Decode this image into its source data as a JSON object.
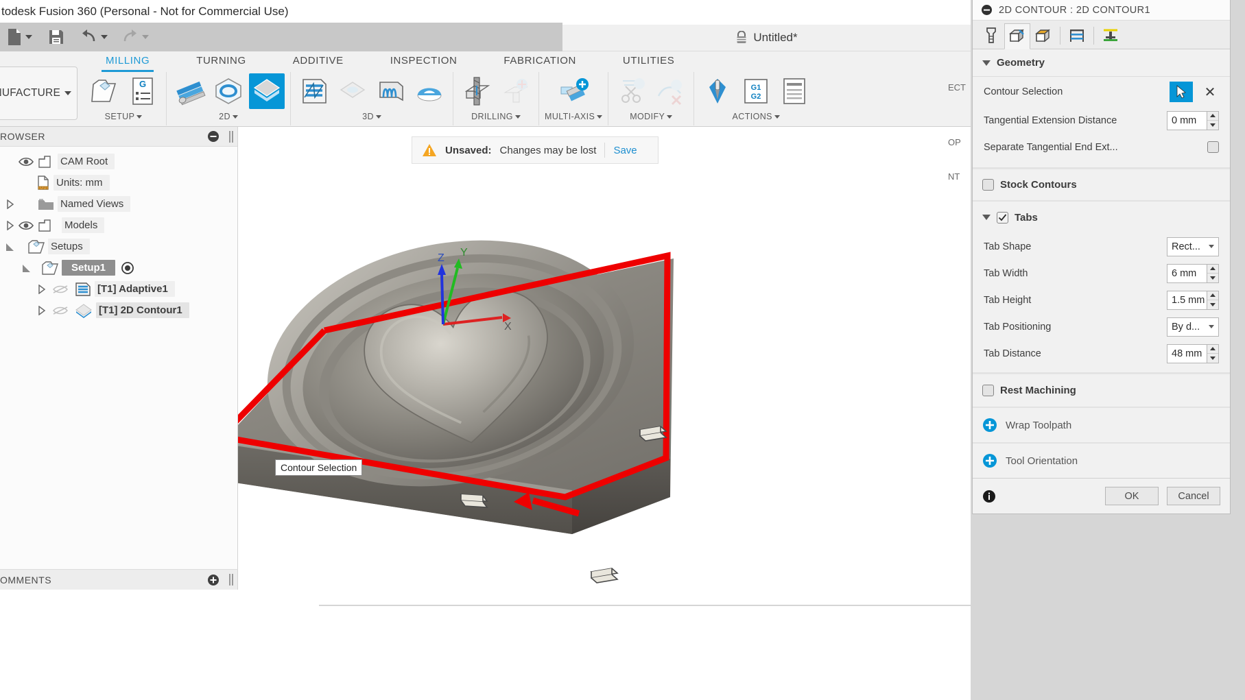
{
  "app": {
    "title": "todesk Fusion 360 (Personal - Not for Commercial Use)",
    "document_tab": "Untitled*"
  },
  "quick_access": {
    "new_label": "new-file",
    "save_label": "save",
    "undo_label": "undo",
    "redo_label": "redo"
  },
  "workspace": {
    "label": "ANUFACTURE"
  },
  "ribbon": {
    "tabs": [
      {
        "label": "MILLING",
        "active": true
      },
      {
        "label": "TURNING",
        "active": false
      },
      {
        "label": "ADDITIVE",
        "active": false
      },
      {
        "label": "INSPECTION",
        "active": false
      },
      {
        "label": "FABRICATION",
        "active": false
      },
      {
        "label": "UTILITIES",
        "active": false
      }
    ],
    "groups": [
      {
        "label": "SETUP",
        "has_caret": true
      },
      {
        "label": "2D",
        "has_caret": true
      },
      {
        "label": "3D",
        "has_caret": true
      },
      {
        "label": "DRILLING",
        "has_caret": true
      },
      {
        "label": "MULTI-AXIS",
        "has_caret": true
      },
      {
        "label": "MODIFY",
        "has_caret": true
      },
      {
        "label": "ACTIONS",
        "has_caret": true
      }
    ]
  },
  "browser": {
    "header": "ROWSER",
    "tree": [
      {
        "label": "CAM Root",
        "indent": 0,
        "expander": "none",
        "eye": true,
        "icon": "body-icon",
        "selected": false,
        "bold": false
      },
      {
        "label": "Units: mm",
        "indent": 1,
        "expander": "none",
        "eye": false,
        "icon": "units-icon",
        "selected": false,
        "bold": false
      },
      {
        "label": "Named Views",
        "indent": 0,
        "expander": "collapsed",
        "eye": false,
        "icon": "folder-icon",
        "selected": false,
        "bold": false
      },
      {
        "label": "Models",
        "indent": 0,
        "expander": "collapsed",
        "eye": true,
        "icon": "body-icon",
        "selected": false,
        "bold": false
      },
      {
        "label": "Setups",
        "indent": 0,
        "expander": "expanded",
        "eye": false,
        "icon": "setup-icon",
        "selected": false,
        "bold": false
      },
      {
        "label": "Setup1",
        "indent": 1,
        "expander": "expanded",
        "eye": false,
        "icon": "setup-icon",
        "selected": true,
        "bold": true,
        "radio": true
      },
      {
        "label": "[T1] Adaptive1",
        "indent": 2,
        "expander": "collapsed",
        "eye": false,
        "hidden_eye": true,
        "icon": "adaptive-icon",
        "selected": false,
        "bold": true
      },
      {
        "label": "[T1] 2D Contour1",
        "indent": 2,
        "expander": "collapsed",
        "eye": false,
        "hidden_eye": true,
        "icon": "contour-icon",
        "selected": false,
        "bold": true,
        "highlight": true
      }
    ]
  },
  "comments": {
    "label": "OMMENTS"
  },
  "canvas": {
    "unsaved": {
      "title": "Unsaved:",
      "message": "Changes may be lost",
      "save_label": "Save"
    },
    "tooltip": "Contour Selection",
    "axis_labels": {
      "x": "X",
      "y": "Y",
      "z": "Z"
    },
    "colors": {
      "contour_highlight": "#ee0000",
      "axis_x": "#dd2222",
      "axis_y": "#22bb22",
      "axis_z": "#2233dd"
    }
  },
  "navbar": {
    "buttons": [
      {
        "name": "orbit-icon",
        "caret": true
      },
      {
        "name": "look-at-icon",
        "caret": false
      },
      {
        "name": "pan-icon",
        "caret": false
      },
      {
        "name": "zoom-icon",
        "caret": false
      },
      {
        "name": "zoom-window-icon",
        "caret": true
      },
      {
        "name": "display-settings-icon",
        "caret": true
      },
      {
        "name": "grid-snap-icon",
        "caret": true
      },
      {
        "name": "viewports-icon",
        "caret": true
      },
      {
        "name": "layout-icon",
        "caret": true
      },
      {
        "name": "refresh-icon",
        "caret": true
      },
      {
        "name": "appearance-icon",
        "caret": true
      },
      {
        "name": "filter-icon",
        "caret": true
      }
    ]
  },
  "dialog": {
    "title": "2D CONTOUR : 2D CONTOUR1",
    "tabs": [
      {
        "name": "tool-tab",
        "icon": "endmill-icon",
        "active": false
      },
      {
        "name": "geometry-tab",
        "icon": "geometry-icon",
        "active": true
      },
      {
        "name": "heights-tab",
        "icon": "heights-icon",
        "active": false
      },
      {
        "name": "passes-tab",
        "icon": "passes-icon",
        "active": false
      },
      {
        "name": "linking-tab",
        "icon": "linking-icon",
        "active": false
      }
    ],
    "geometry": {
      "section_title": "Geometry",
      "contour_selection_label": "Contour Selection",
      "tangential_extension_label": "Tangential Extension Distance",
      "tangential_extension_value": "0 mm",
      "separate_tangential_label": "Separate Tangential End Ext...",
      "separate_tangential_checked": false
    },
    "stock_contours": {
      "label": "Stock Contours",
      "checked": false
    },
    "tabs_section": {
      "label": "Tabs",
      "checked": true,
      "rows": [
        {
          "label": "Tab Shape",
          "value": "Rect...",
          "type": "combo"
        },
        {
          "label": "Tab Width",
          "value": "6 mm",
          "type": "spin"
        },
        {
          "label": "Tab Height",
          "value": "1.5 mm",
          "type": "spin"
        },
        {
          "label": "Tab Positioning",
          "value": "By d...",
          "type": "combo"
        },
        {
          "label": "Tab Distance",
          "value": "48 mm",
          "type": "spin"
        }
      ]
    },
    "rest_machining": {
      "label": "Rest Machining",
      "checked": false
    },
    "links": [
      {
        "label": "Wrap Toolpath",
        "icon": "add-circle-icon"
      },
      {
        "label": "Tool Orientation",
        "icon": "add-circle-icon"
      }
    ],
    "footer": {
      "info_icon": "info-icon",
      "ok_label": "OK",
      "cancel_label": "Cancel"
    },
    "accent_color": "#0696d7"
  },
  "right_strip": {
    "fragments": [
      "ECT",
      "OP",
      "NT"
    ]
  }
}
